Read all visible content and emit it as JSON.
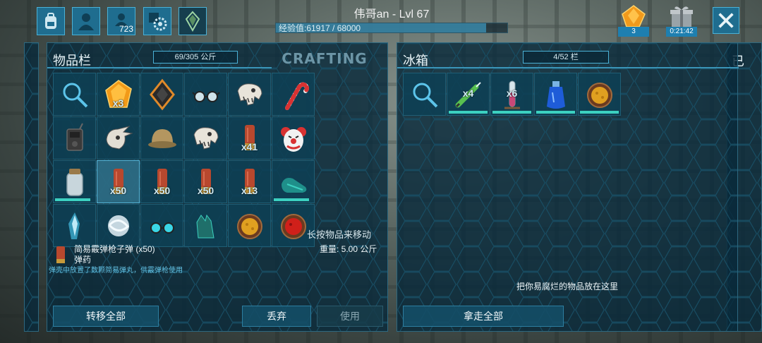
{
  "hud": {
    "player_title": "伟哥an - Lvl 67",
    "xp_text": "经验值:61917 / 68000",
    "xp_progress": 0.91,
    "tribe_count": "723",
    "gem_count": "3",
    "timer": "0:21:42",
    "icons": [
      "backpack-icon",
      "character-icon",
      "tribe-icon",
      "engram-gear-icon",
      "crystal-icon",
      "gem-icon",
      "gift-icon",
      "close-icon"
    ]
  },
  "inventory": {
    "title": "物品栏",
    "capacity": "69/305 公斤",
    "crafting_tab": "CRAFTING",
    "slots": [
      {
        "icon": "search-icon",
        "qty": ""
      },
      {
        "icon": "amber-icon",
        "qty": "x3"
      },
      {
        "icon": "implant-icon",
        "qty": ""
      },
      {
        "icon": "glasses-icon",
        "qty": ""
      },
      {
        "icon": "dino-skull-icon",
        "qty": ""
      },
      {
        "icon": "candy-cane-icon",
        "qty": ""
      },
      {
        "icon": "radio-icon",
        "qty": ""
      },
      {
        "icon": "trike-skull-icon",
        "qty": ""
      },
      {
        "icon": "pith-helmet-icon",
        "qty": ""
      },
      {
        "icon": "dino-skull-icon",
        "qty": ""
      },
      {
        "icon": "shotgun-shell-icon",
        "qty": "x41"
      },
      {
        "icon": "clown-mask-icon",
        "qty": ""
      },
      {
        "icon": "water-jar-icon",
        "qty": "",
        "durability": 0.9
      },
      {
        "icon": "shotgun-shell-icon",
        "qty": "x50",
        "selected": true
      },
      {
        "icon": "shotgun-shell-icon",
        "qty": "x50"
      },
      {
        "icon": "shotgun-shell-icon",
        "qty": "x50"
      },
      {
        "icon": "shotgun-shell-icon",
        "qty": "x13"
      },
      {
        "icon": "flippers-icon",
        "qty": "",
        "durability": 0.9
      },
      {
        "icon": "crystal-shard-icon",
        "qty": ""
      },
      {
        "icon": "silk-orb-icon",
        "qty": ""
      },
      {
        "icon": "cyan-goggles-icon",
        "qty": ""
      },
      {
        "icon": "chitin-gloves-icon",
        "qty": ""
      },
      {
        "icon": "stew-orange-icon",
        "qty": ""
      },
      {
        "icon": "stew-red-icon",
        "qty": ""
      }
    ],
    "selected_name": "简易霰弹枪子弹 (x50)",
    "selected_type": "弹药",
    "selected_desc": "弹壳中放置了数颗简易弹丸，供霰弹枪使用",
    "hint": "长按物品来移动",
    "weight": "重量: 5.00 公斤",
    "transfer_all": "转移全部",
    "drop": "丢弃",
    "use": "使用"
  },
  "fridge": {
    "title": "冰箱",
    "capacity": "4/52 栏",
    "slots": [
      {
        "icon": "search-icon",
        "qty": ""
      },
      {
        "icon": "syringe-icon",
        "qty": "x4",
        "durability": 1
      },
      {
        "icon": "test-tube-icon",
        "qty": "x6",
        "durability": 1
      },
      {
        "icon": "blue-potion-icon",
        "qty": "",
        "durability": 1
      },
      {
        "icon": "stew-orange-icon",
        "qty": "",
        "durability": 1
      }
    ],
    "empty_hint": "把你易腐烂的物品放在这里",
    "take_all": "拿走全部"
  }
}
